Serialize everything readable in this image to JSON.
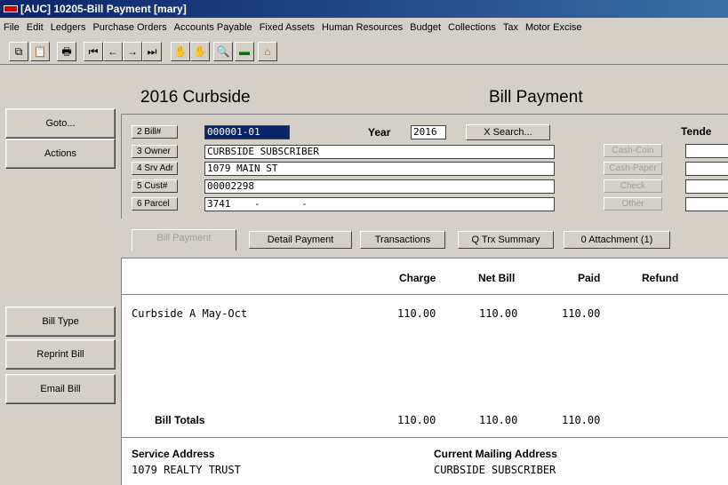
{
  "window": {
    "title": "[AUC] 10205-Bill Payment [mary]"
  },
  "menu": [
    "File",
    "Edit",
    "Ledgers",
    "Purchase Orders",
    "Accounts Payable",
    "Fixed Assets",
    "Human Resources",
    "Budget",
    "Collections",
    "Tax",
    "Motor Excise"
  ],
  "header": {
    "left_title": "2016 Curbside",
    "right_title": "Bill Payment"
  },
  "side_buttons": {
    "goto": "Goto...",
    "actions": "Actions",
    "bill_type": "Bill Type",
    "reprint_bill": "Reprint Bill",
    "email_bill": "Email Bill"
  },
  "form": {
    "bill_label": "2 Bill#",
    "bill_value": "000001-01",
    "year_label": "Year",
    "year_value": "2016",
    "search_label": "X Search...",
    "owner_label": "3 Owner",
    "owner_value": "CURBSIDE SUBSCRIBER",
    "srvadr_label": "4 Srv Adr",
    "srvadr_value": "1079 MAIN ST",
    "cust_label": "5 Cust#",
    "cust_value": "00002298",
    "parcel_label": "6 Parcel",
    "parcel_value": "3741    -       -",
    "tender_label": "Tende"
  },
  "tender": {
    "cash_coin": "Cash-Coin",
    "cash_paper": "Cash-Paper",
    "check": "Check",
    "other": "Other"
  },
  "tabs": [
    "Bill Payment",
    "Detail Payment",
    "Transactions",
    "Q Trx Summary",
    "0 Attachment (1)"
  ],
  "table": {
    "columns": [
      "Charge",
      "Net Bill",
      "Paid",
      "Refund"
    ],
    "rows": [
      {
        "description": "Curbside A May-Oct",
        "charge": "110.00",
        "net_bill": "110.00",
        "paid": "110.00"
      }
    ],
    "totals": {
      "label": "Bill Totals",
      "charge": "110.00",
      "net_bill": "110.00",
      "paid": "110.00"
    }
  },
  "footer": {
    "service_address_label": "Service Address",
    "service_address_value": "1079 REALTY TRUST",
    "mailing_address_label": "Current Mailing Address",
    "mailing_address_value": "CURBSIDE SUBSCRIBER"
  },
  "colors": {
    "titlebar": "#0a246a",
    "selection": "#0a246a",
    "window_bg": "#d4d0c8"
  }
}
